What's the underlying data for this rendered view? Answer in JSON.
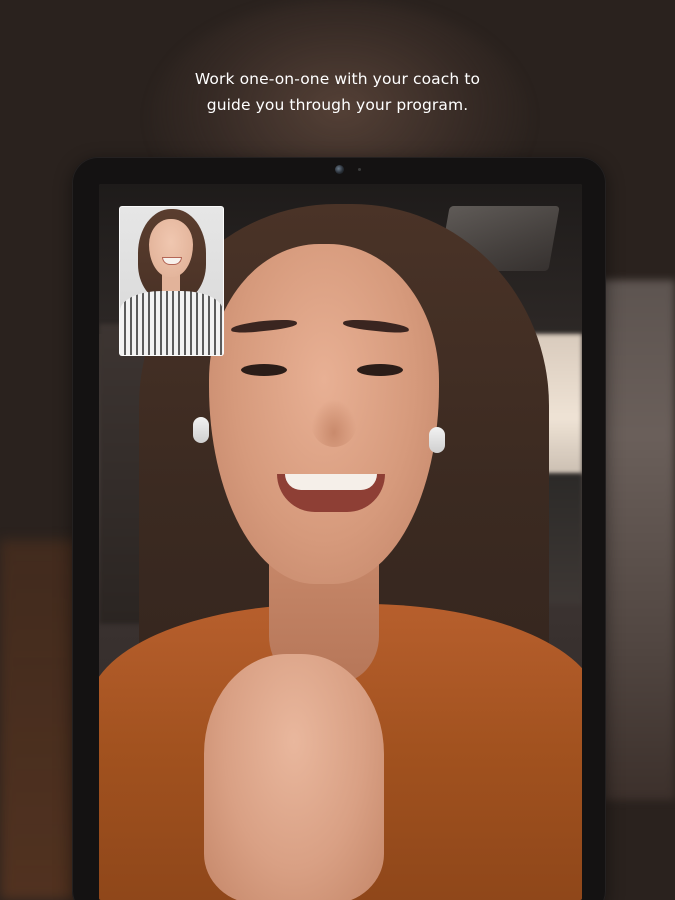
{
  "headline": {
    "line1": "Work one-on-one with your coach to",
    "line2": "guide you through your program."
  },
  "video_call": {
    "main_participant": "client-video",
    "pip_participant": "coach-video"
  },
  "colors": {
    "background": "#2a221e",
    "headline_text": "#ffffff",
    "device_frame": "#141212",
    "jacket_accent": "#b75f2d"
  },
  "icons": {
    "camera": "camera-icon"
  }
}
